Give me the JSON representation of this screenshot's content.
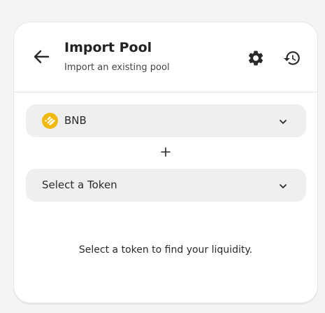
{
  "header": {
    "title": "Import Pool",
    "subtitle": "Import an existing pool",
    "icons": {
      "back": "arrow-left-icon",
      "settings": "gear-icon",
      "history": "history-icon"
    }
  },
  "token_a": {
    "label": "BNB",
    "icon": "bnb-logo-icon",
    "logo_color": "#f0b90b"
  },
  "separator": {
    "icon": "plus-icon"
  },
  "token_b": {
    "label": "Select a Token"
  },
  "message": "Select a token to find your liquidity.",
  "colors": {
    "page_background": "#f4f4f4",
    "card_background": "#ffffff",
    "field_background": "#efeff0",
    "text": "#2a2a2a"
  }
}
